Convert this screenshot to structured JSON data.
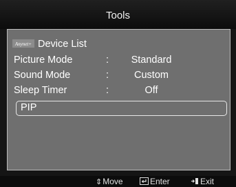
{
  "header": {
    "title": "Tools"
  },
  "menu": {
    "device_list": {
      "logo_text": "Anynet+",
      "label": "Device List"
    },
    "items": [
      {
        "label": "Picture Mode",
        "separator": ":",
        "value": "Standard"
      },
      {
        "label": "Sound Mode",
        "separator": ":",
        "value": "Custom"
      },
      {
        "label": "Sleep Timer",
        "separator": ":",
        "value": "Off"
      }
    ],
    "selected": {
      "label": "PIP"
    }
  },
  "footer": {
    "move": {
      "icon": "up-down-arrows-icon",
      "label": "Move"
    },
    "enter": {
      "icon": "enter-key-icon",
      "label": "Enter"
    },
    "exit": {
      "icon": "exit-icon",
      "label": "Exit"
    }
  },
  "colors": {
    "panel": "#6f6f6f",
    "background": "#151515",
    "text": "#ffffff",
    "highlight_border": "#e8e8e8"
  }
}
